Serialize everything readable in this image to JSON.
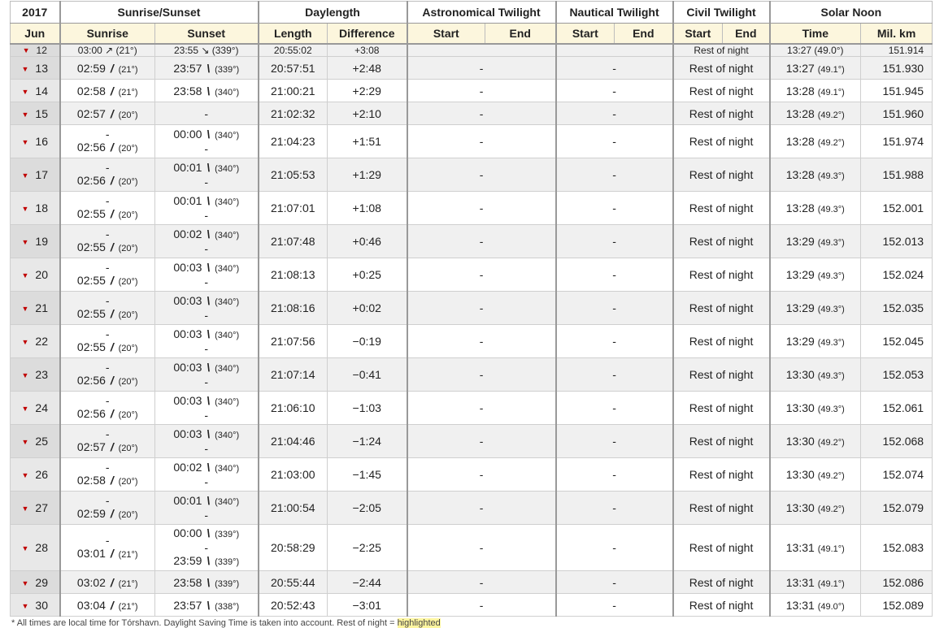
{
  "header": {
    "year": "2017",
    "month": "Jun",
    "groups": [
      "Sunrise/Sunset",
      "Daylength",
      "Astronomical Twilight",
      "Nautical Twilight",
      "Civil Twilight",
      "Solar Noon"
    ],
    "subcols": [
      "Sunrise",
      "Sunset",
      "Length",
      "Difference",
      "Start",
      "End",
      "Start",
      "End",
      "Start",
      "End",
      "Time",
      "Mil. km"
    ]
  },
  "partial_row": {
    "day": "12",
    "sunrise": "03:00 ↗ (21°)",
    "sunset": "23:55 ↘ (339°)",
    "length": "20:55:02",
    "diff": "+3:08",
    "civil": "Rest of night",
    "noon": "13:27 (49.0°)",
    "km": "151.914"
  },
  "rows": [
    {
      "day": "13",
      "rise": "02:59",
      "rise_deg": "(21°)",
      "set": "23:57",
      "set_deg": "(339°)",
      "len": "20:57:51",
      "diff": "+2:48",
      "astro": "-",
      "naut": "-",
      "civil": "Rest of night",
      "noon": "13:27",
      "noon_deg": "(49.1°)",
      "km": "151.930"
    },
    {
      "day": "14",
      "rise": "02:58",
      "rise_deg": "(21°)",
      "set": "23:58",
      "set_deg": "(340°)",
      "len": "21:00:21",
      "diff": "+2:29",
      "astro": "-",
      "naut": "-",
      "civil": "Rest of night",
      "noon": "13:28",
      "noon_deg": "(49.1°)",
      "km": "151.945"
    },
    {
      "day": "15",
      "rise": "02:57",
      "rise_deg": "(20°)",
      "set": "-",
      "len": "21:02:32",
      "diff": "+2:10",
      "astro": "-",
      "naut": "-",
      "civil": "Rest of night",
      "noon": "13:28",
      "noon_deg": "(49.2°)",
      "km": "151.960"
    },
    {
      "day": "16",
      "rise": "02:56",
      "rise_deg": "(20°)",
      "set": "00:00",
      "set_deg": "(340°)",
      "len": "21:04:23",
      "diff": "+1:51",
      "astro": "-",
      "naut": "-",
      "civil": "Rest of night",
      "noon": "13:28",
      "noon_deg": "(49.2°)",
      "km": "151.974"
    },
    {
      "day": "17",
      "rise": "02:56",
      "rise_deg": "(20°)",
      "set": "00:01",
      "set_deg": "(340°)",
      "len": "21:05:53",
      "diff": "+1:29",
      "astro": "-",
      "naut": "-",
      "civil": "Rest of night",
      "noon": "13:28",
      "noon_deg": "(49.3°)",
      "km": "151.988"
    },
    {
      "day": "18",
      "rise": "02:55",
      "rise_deg": "(20°)",
      "set": "00:01",
      "set_deg": "(340°)",
      "len": "21:07:01",
      "diff": "+1:08",
      "astro": "-",
      "naut": "-",
      "civil": "Rest of night",
      "noon": "13:28",
      "noon_deg": "(49.3°)",
      "km": "152.001"
    },
    {
      "day": "19",
      "rise": "02:55",
      "rise_deg": "(20°)",
      "set": "00:02",
      "set_deg": "(340°)",
      "len": "21:07:48",
      "diff": "+0:46",
      "astro": "-",
      "naut": "-",
      "civil": "Rest of night",
      "noon": "13:29",
      "noon_deg": "(49.3°)",
      "km": "152.013"
    },
    {
      "day": "20",
      "rise": "02:55",
      "rise_deg": "(20°)",
      "set": "00:03",
      "set_deg": "(340°)",
      "len": "21:08:13",
      "diff": "+0:25",
      "astro": "-",
      "naut": "-",
      "civil": "Rest of night",
      "noon": "13:29",
      "noon_deg": "(49.3°)",
      "km": "152.024"
    },
    {
      "day": "21",
      "rise": "02:55",
      "rise_deg": "(20°)",
      "set": "00:03",
      "set_deg": "(340°)",
      "len": "21:08:16",
      "diff": "+0:02",
      "astro": "-",
      "naut": "-",
      "civil": "Rest of night",
      "noon": "13:29",
      "noon_deg": "(49.3°)",
      "km": "152.035"
    },
    {
      "day": "22",
      "rise": "02:55",
      "rise_deg": "(20°)",
      "set": "00:03",
      "set_deg": "(340°)",
      "len": "21:07:56",
      "diff": "−0:19",
      "astro": "-",
      "naut": "-",
      "civil": "Rest of night",
      "noon": "13:29",
      "noon_deg": "(49.3°)",
      "km": "152.045"
    },
    {
      "day": "23",
      "rise": "02:56",
      "rise_deg": "(20°)",
      "set": "00:03",
      "set_deg": "(340°)",
      "len": "21:07:14",
      "diff": "−0:41",
      "astro": "-",
      "naut": "-",
      "civil": "Rest of night",
      "noon": "13:30",
      "noon_deg": "(49.3°)",
      "km": "152.053"
    },
    {
      "day": "24",
      "rise": "02:56",
      "rise_deg": "(20°)",
      "set": "00:03",
      "set_deg": "(340°)",
      "len": "21:06:10",
      "diff": "−1:03",
      "astro": "-",
      "naut": "-",
      "civil": "Rest of night",
      "noon": "13:30",
      "noon_deg": "(49.3°)",
      "km": "152.061"
    },
    {
      "day": "25",
      "rise": "02:57",
      "rise_deg": "(20°)",
      "set": "00:03",
      "set_deg": "(340°)",
      "len": "21:04:46",
      "diff": "−1:24",
      "astro": "-",
      "naut": "-",
      "civil": "Rest of night",
      "noon": "13:30",
      "noon_deg": "(49.2°)",
      "km": "152.068"
    },
    {
      "day": "26",
      "rise": "02:58",
      "rise_deg": "(20°)",
      "set": "00:02",
      "set_deg": "(340°)",
      "len": "21:03:00",
      "diff": "−1:45",
      "astro": "-",
      "naut": "-",
      "civil": "Rest of night",
      "noon": "13:30",
      "noon_deg": "(49.2°)",
      "km": "152.074"
    },
    {
      "day": "27",
      "rise": "02:59",
      "rise_deg": "(20°)",
      "set": "00:01",
      "set_deg": "(340°)",
      "len": "21:00:54",
      "diff": "−2:05",
      "astro": "-",
      "naut": "-",
      "civil": "Rest of night",
      "noon": "13:30",
      "noon_deg": "(49.2°)",
      "km": "152.079"
    },
    {
      "day": "28",
      "rise": "03:01",
      "rise_deg": "(21°)",
      "set": "00:00",
      "set_deg": "(339°)",
      "set2": "23:59",
      "set2_deg": "(339°)",
      "len": "20:58:29",
      "diff": "−2:25",
      "astro": "-",
      "naut": "-",
      "civil": "Rest of night",
      "noon": "13:31",
      "noon_deg": "(49.1°)",
      "km": "152.083"
    },
    {
      "day": "29",
      "rise": "03:02",
      "rise_deg": "(21°)",
      "set": "23:58",
      "set_deg": "(339°)",
      "len": "20:55:44",
      "diff": "−2:44",
      "astro": "-",
      "naut": "-",
      "civil": "Rest of night",
      "noon": "13:31",
      "noon_deg": "(49.1°)",
      "km": "152.086"
    },
    {
      "day": "30",
      "rise": "03:04",
      "rise_deg": "(21°)",
      "set": "23:57",
      "set_deg": "(338°)",
      "len": "20:52:43",
      "diff": "−3:01",
      "astro": "-",
      "naut": "-",
      "civil": "Rest of night",
      "noon": "13:31",
      "noon_deg": "(49.0°)",
      "km": "152.089"
    }
  ],
  "footer": {
    "text": "* All times are local time for Tórshavn. Daylight Saving Time is taken into account. Rest of night =",
    "highlight": "highlighted"
  },
  "icons": {
    "sunrise": "sunrise-arrow-icon",
    "sunset": "sunset-arrow-icon",
    "row": "expand-triangle-icon"
  },
  "colors": {
    "accent_red": "#c00000",
    "header_bg": "#fcf6dd",
    "alt_row": "#f0f0f0",
    "day_cell": "#e8e8e8"
  }
}
